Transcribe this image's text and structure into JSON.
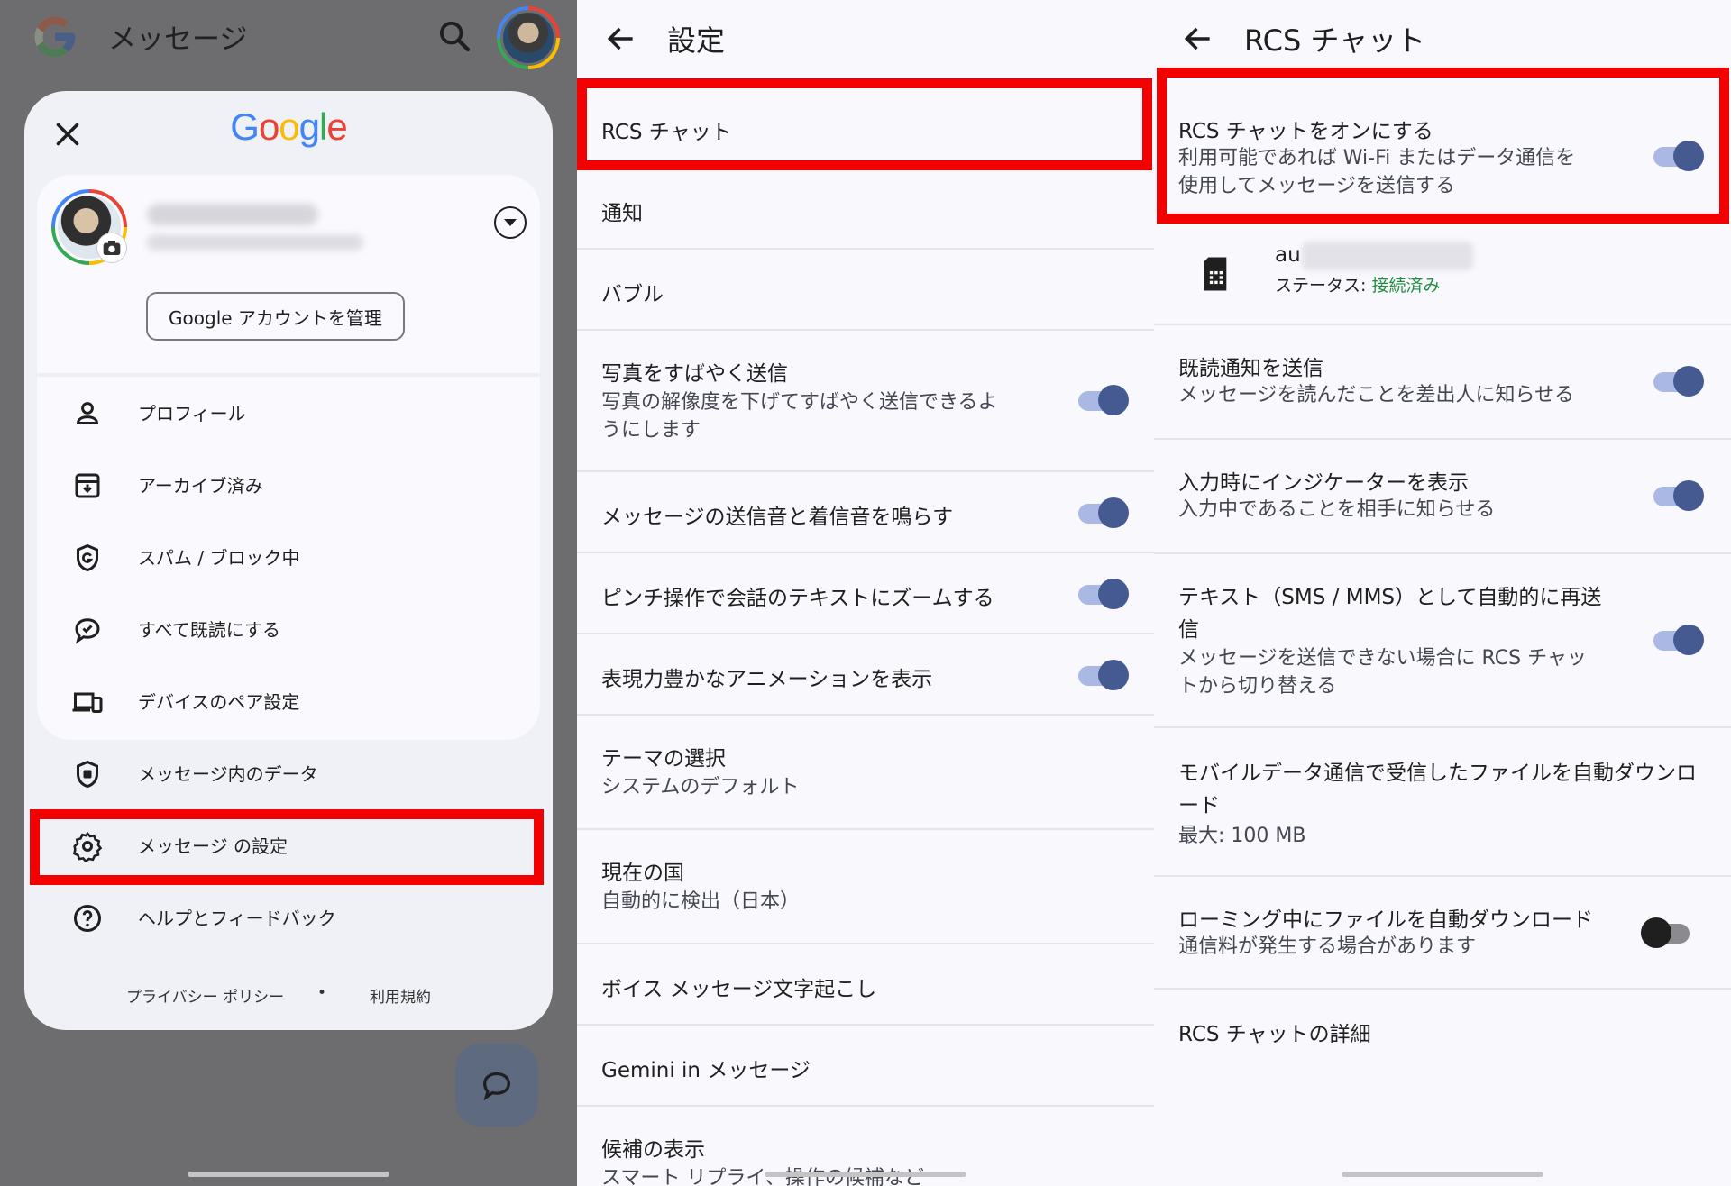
{
  "panel1": {
    "app_title": "メッセージ",
    "google_wordmark": "Google",
    "manage_account": "Google アカウントを管理",
    "menu": [
      {
        "label": "プロフィール",
        "icon": "person-icon"
      },
      {
        "label": "アーカイブ済み",
        "icon": "archive-icon"
      },
      {
        "label": "スパム / ブロック中",
        "icon": "spam-shield-icon"
      },
      {
        "label": "すべて既読にする",
        "icon": "mark-read-icon"
      },
      {
        "label": "デバイスのペア設定",
        "icon": "devices-icon"
      },
      {
        "label": "メッセージ内のデータ",
        "icon": "data-shield-icon"
      },
      {
        "label": "メッセージ の設定",
        "icon": "gear-icon"
      },
      {
        "label": "ヘルプとフィードバック",
        "icon": "help-icon"
      }
    ],
    "privacy_policy": "プライバシー ポリシー",
    "separator": "•",
    "terms": "利用規約"
  },
  "panel2": {
    "title": "設定",
    "rows": [
      {
        "title": "RCS チャット"
      },
      {
        "title": "通知"
      },
      {
        "title": "バブル"
      },
      {
        "title": "写真をすばやく送信",
        "subtitle1": "写真の解像度を下げてすばやく送信できるよ",
        "subtitle2": "うにします",
        "toggle": true
      },
      {
        "title": "メッセージの送信音と着信音を鳴らす",
        "toggle": true
      },
      {
        "title": "ピンチ操作で会話のテキストにズームする",
        "toggle": true
      },
      {
        "title": "表現力豊かなアニメーションを表示",
        "toggle": true
      },
      {
        "title": "テーマの選択",
        "subtitle1": "システムのデフォルト"
      },
      {
        "title": "現在の国",
        "subtitle1": "自動的に検出（日本）"
      },
      {
        "title": "ボイス メッセージ文字起こし"
      },
      {
        "title": "Gemini in メッセージ"
      },
      {
        "title": "候補の表示",
        "subtitle1": "スマート リプライ、操作の候補など"
      }
    ]
  },
  "panel3": {
    "title": "RCS チャット",
    "rcs_toggle": {
      "title": "RCS チャットをオンにする",
      "subtitle1": "利用可能であれば Wi-Fi またはデータ通信を",
      "subtitle2": "使用してメッセージを送信する",
      "on": true
    },
    "sim": {
      "carrier": "au",
      "status_label": "ステータス: ",
      "status_value": "接続済み",
      "icon": "sim-card-icon"
    },
    "rows": [
      {
        "title": "既読通知を送信",
        "subtitle1": "メッセージを読んだことを差出人に知らせる",
        "toggle": "on"
      },
      {
        "title": "入力時にインジケーターを表示",
        "subtitle1": "入力中であることを相手に知らせる",
        "toggle": "on"
      },
      {
        "title": "テキスト（SMS / MMS）として自動的に再送",
        "title2": "信",
        "subtitle1": "メッセージを送信できない場合に RCS チャッ",
        "subtitle2": "トから切り替える",
        "toggle": "on"
      },
      {
        "title": "モバイルデータ通信で受信したファイルを自動ダウンロ",
        "title2": "ード",
        "subtitle1": "最大: 100 MB"
      },
      {
        "title": "ローミング中にファイルを自動ダウンロード",
        "subtitle1": "通信料が発生する場合があります",
        "toggle": "off"
      },
      {
        "title": "RCS チャットの詳細"
      }
    ]
  },
  "colors": {
    "highlight": "#f30000",
    "toggle_on": "#455a91",
    "connected": "#1e8e3e"
  }
}
